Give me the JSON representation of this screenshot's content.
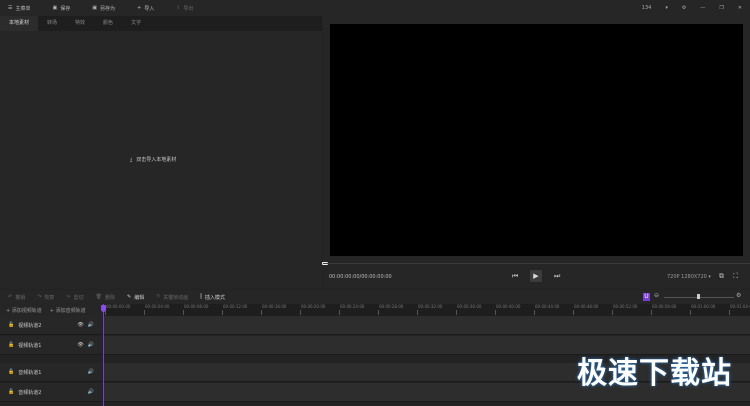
{
  "toolbar": {
    "menu": "主菜单",
    "save": "保存",
    "save_as": "另存为",
    "import": "导入",
    "export": "导出",
    "zoom": "134"
  },
  "tabs": [
    "本地素材",
    "转场",
    "特效",
    "颜色",
    "文字"
  ],
  "media": {
    "import_hint": "双击导入本地素材"
  },
  "preview": {
    "timecode": "00:00:00:00/00:00:00:00",
    "resolution": "720P 1280X720"
  },
  "edit": {
    "undo": "撤销",
    "redo": "恢复",
    "cut": "剪切",
    "delete": "删除",
    "edit": "编辑",
    "keyframe": "关键帧动画",
    "insert_mode": "插入模式",
    "u_badge": "U"
  },
  "timeline": {
    "add_video": "添加视频轨道",
    "add_audio": "添加音频轨道",
    "ticks": [
      "00:00:00:00",
      "00:00:04:00",
      "00:00:08:00",
      "00:00:12:00",
      "00:00:16:00",
      "00:00:20:00",
      "00:00:24:00",
      "00:00:28:00",
      "00:00:32:00",
      "00:00:36:00",
      "00:00:40:00",
      "00:00:44:00",
      "00:00:48:00",
      "00:00:52:00",
      "00:00:56:00",
      "00:01:00:00",
      "00:01:04:00"
    ],
    "tracks": [
      "视频轨道2",
      "视频轨道1",
      "音频轨道1",
      "音频轨道2"
    ]
  },
  "watermark": "极速下载站",
  "colors": {
    "accent": "#8a4fe0",
    "bg": "#232323"
  }
}
